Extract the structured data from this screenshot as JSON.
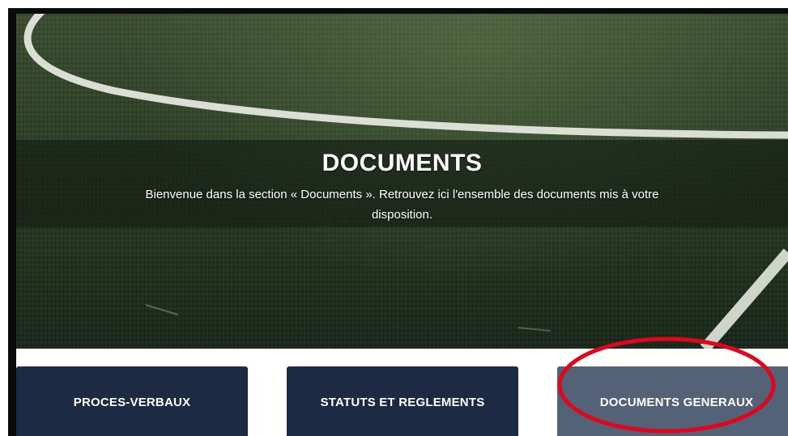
{
  "hero": {
    "title": "DOCUMENTS",
    "subtitle": "Bienvenue dans la section « Documents ». Retrouvez ici l'ensemble des documents mis à votre disposition."
  },
  "buttons": [
    {
      "label": "PROCES-VERBAUX"
    },
    {
      "label": "STATUTS ET REGLEMENTS"
    },
    {
      "label": "DOCUMENTS GENERAUX",
      "highlighted": true
    }
  ],
  "colors": {
    "button_dark": "#1c2a44",
    "button_active": "#546278",
    "annotation": "#e0061b",
    "field_green": "#2f4227"
  }
}
